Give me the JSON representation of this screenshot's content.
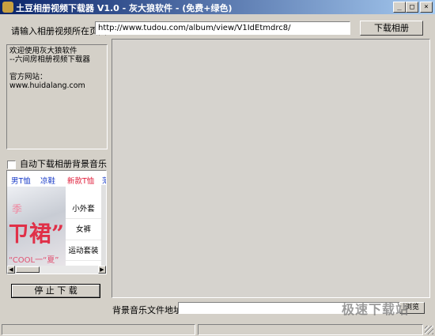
{
  "window": {
    "title": "土豆相册视频下载器 V1.0 - 灰大狼软件 - (免费+绿色)",
    "controls": {
      "minimize": "_",
      "maximize": "□",
      "close": "×"
    }
  },
  "url_row": {
    "label": "请输入相册视频所在页面：",
    "value": "http://www.tudou.com/album/view/V1IdEtmdrc8/",
    "button": "下载相册"
  },
  "info": {
    "line1": "欢迎使用灰大狼软件",
    "line2": "--六间房相册视频下载器",
    "line3": "官方网站：",
    "line4": "www.huidalang.com"
  },
  "options": {
    "auto_music_label": "自动下载相册背景音乐",
    "auto_music_checked": false
  },
  "ad": {
    "tabs": [
      "男T恤",
      "凉鞋",
      "新款T恤",
      "薄"
    ],
    "menu": [
      "小外套",
      "女裤",
      "运动套装"
    ],
    "image_text_small": "季",
    "image_text_big": "ㄗ裙”",
    "image_text_cool": "“COOL一“夏”"
  },
  "buttons": {
    "stop": "停 止 下 载",
    "browse": "浏览"
  },
  "music": {
    "label": "背景音乐文件地址：",
    "value": ""
  },
  "watermark": "极速下载站",
  "colors": {
    "face": "#d4d0c8",
    "title_start": "#0a246a",
    "title_end": "#a6caf0",
    "tab_link": "#1a3cc8",
    "tab_hot": "#e0203c"
  }
}
